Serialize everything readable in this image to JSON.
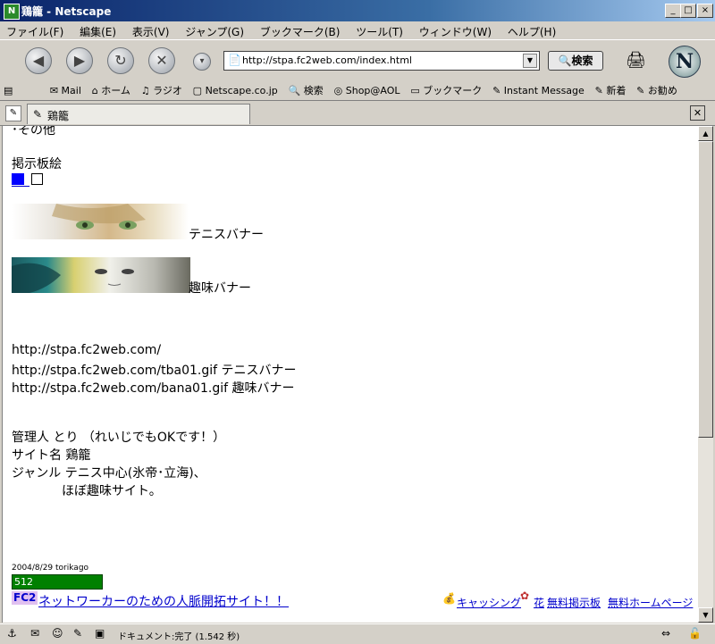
{
  "window": {
    "title": "鶏籠 - Netscape"
  },
  "menu": [
    "ファイル(F)",
    "編集(E)",
    "表示(V)",
    "ジャンプ(G)",
    "ブックマーク(B)",
    "ツール(T)",
    "ウィンドウ(W)",
    "ヘルプ(H)"
  ],
  "nav": {
    "url": "http://stpa.fc2web.com/index.html",
    "search_label": "検索"
  },
  "bookmarks": [
    "Mail",
    "ホーム",
    "ラジオ",
    "Netscape.co.jp",
    "検索",
    "Shop@AOL",
    "ブックマーク",
    "Instant Message",
    "新着",
    "お勧め"
  ],
  "tab": {
    "title": "鶏籠"
  },
  "page": {
    "top_cut": "･その他",
    "bbs_title": "掲示板絵",
    "tennis_banner": "テニスバナー",
    "hobby_banner": "趣味バナー",
    "urls": [
      "http://stpa.fc2web.com/",
      "http://stpa.fc2web.com/tba01.gif  テニスバナー",
      "http://stpa.fc2web.com/bana01.gif 趣味バナー"
    ],
    "info": [
      "管理人  とり （れいじでもOKです！）",
      "サイト名  鶏籠",
      "ジャンル  テニス中心(氷帝･立海)、",
      "ほぼ趣味サイト。"
    ],
    "counter_date": "2004/8/29 torikago",
    "counter": "512",
    "fc2_badge": "FC2",
    "fc2_link": "ネットワーカーのための人脈開拓サイト！！",
    "footer_links": [
      "キャッシング",
      "花",
      "無料掲示板",
      "無料ホームページ"
    ]
  },
  "status": {
    "text": "ドキュメント:完了 (1.542 秒)"
  },
  "colors": {
    "link": "#0000cc",
    "counter_bg": "#008000",
    "titlebar": "#0a246a"
  }
}
